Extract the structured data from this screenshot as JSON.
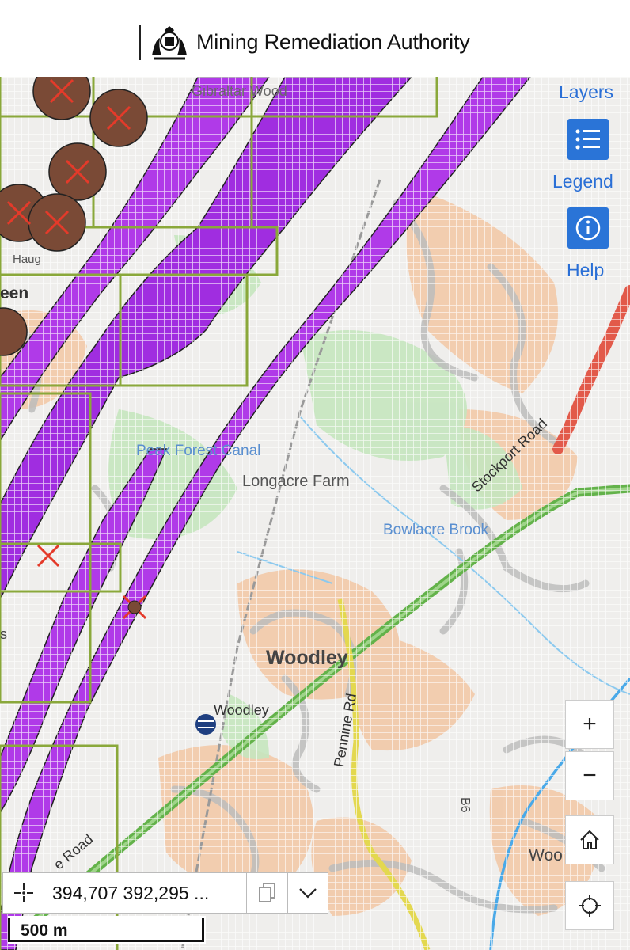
{
  "header": {
    "org_name": "Mining Remediation Authority",
    "crest_icon": "royal-coat-of-arms-icon"
  },
  "map": {
    "labels": {
      "area_top": "Gibraltar Wood",
      "area_left": "een",
      "area_left2": "Haug",
      "canal": "Peak Forest Canal",
      "farm": "Longacre Farm",
      "brook": "Bowlacre Brook",
      "town": "Woodley",
      "station": "Woodley",
      "stockport_road": "Stockport Road",
      "pennine_road": "Pennine Rd",
      "road_bottom_left": "e Road",
      "road_bottom_right": "Woo",
      "left_s": "s",
      "b_road": "B6"
    },
    "colors": {
      "seam": "#a02de0",
      "boundary": "#8aa83a",
      "shaft": "#6b3a2a",
      "road_a": "#63b24a",
      "road_b": "#e3d84f",
      "road_red": "#e25a4a",
      "water": "#4aa9e8"
    }
  },
  "controls": {
    "layers_label": "Layers",
    "legend_label": "Legend",
    "help_label": "Help",
    "legend_icon": "list-icon",
    "help_icon": "info-icon",
    "zoom_in_label": "+",
    "zoom_out_label": "−",
    "home_icon": "home-icon",
    "locate_icon": "crosshair-locate-icon"
  },
  "coordinates": {
    "value": "394,707 392,295 ...",
    "crosshair_icon": "crosshair-icon",
    "copy_icon": "copy-icon",
    "expand_icon": "chevron-down-icon"
  },
  "scale": {
    "label": "500 m"
  }
}
